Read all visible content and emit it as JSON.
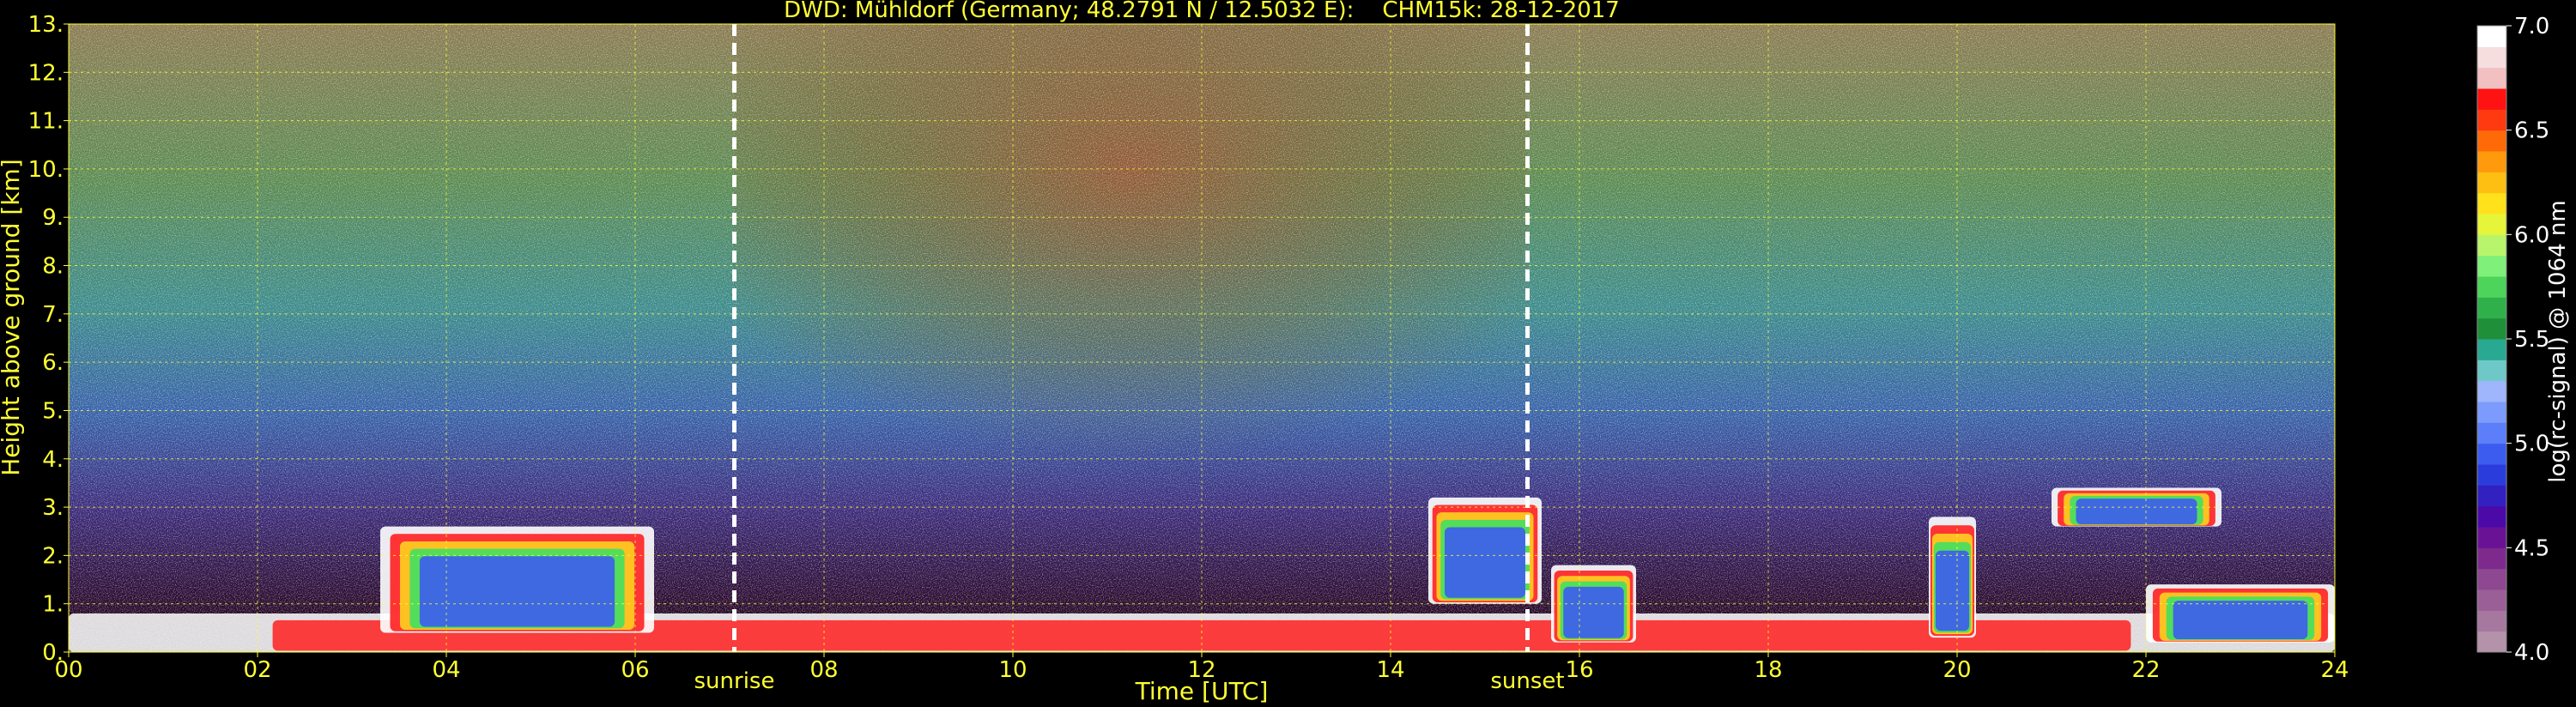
{
  "chart_data": {
    "type": "heatmap",
    "title": "DWD: Mühldorf (Germany; 48.2791 N / 12.5032 E):    CHM15k: 28-12-2017",
    "xlabel": "Time [UTC]",
    "ylabel": "Height above ground [km]",
    "xlim": [
      0,
      24
    ],
    "ylim": [
      0,
      13
    ],
    "x_ticks": [
      "00",
      "02",
      "04",
      "06",
      "08",
      "10",
      "12",
      "14",
      "16",
      "18",
      "20",
      "22",
      "24"
    ],
    "y_ticks": [
      "0.",
      "1.",
      "2.",
      "3.",
      "4.",
      "5.",
      "6.",
      "7.",
      "8.",
      "9.",
      "10.",
      "11.",
      "12.",
      "13."
    ],
    "grid": true,
    "markers": [
      {
        "label": "sunrise",
        "x": 7.05
      },
      {
        "label": "sunset",
        "x": 15.45
      }
    ],
    "colorbar": {
      "label": "log(rc-signal) @ 1064 nm",
      "range": [
        4.0,
        7.0
      ],
      "ticks": [
        "4.0",
        "4.5",
        "5.0",
        "5.5",
        "6.0",
        "6.5",
        "7.0"
      ],
      "colors": [
        "#b493aa",
        "#a6789f",
        "#9b5f98",
        "#8e4791",
        "#7d2a8c",
        "#6a1296",
        "#4b0aa8",
        "#3320c0",
        "#2a3ddc",
        "#3c5cf0",
        "#5c7ef8",
        "#7d9bfc",
        "#9fb6fc",
        "#6fc8c8",
        "#29a892",
        "#1f8f3a",
        "#2fb04a",
        "#4dd45a",
        "#7ff07a",
        "#b8f56a",
        "#e6f53a",
        "#ffe21c",
        "#ffbf12",
        "#ff9a0c",
        "#ff6a08",
        "#ff3a10",
        "#ff1212",
        "#f2c0c0",
        "#f6dede",
        "#ffffff"
      ]
    },
    "features": [
      {
        "name": "boundary layer aerosol",
        "x": [
          0,
          24
        ],
        "height_km": [
          0,
          0.8
        ]
      },
      {
        "name": "cloud layer",
        "x": [
          3.3,
          6.2
        ],
        "height_km": [
          0.4,
          2.6
        ]
      },
      {
        "name": "cloud layer",
        "x": [
          14.4,
          15.6
        ],
        "height_km": [
          1.0,
          3.2
        ]
      },
      {
        "name": "cloud layer",
        "x": [
          15.7,
          16.6
        ],
        "height_km": [
          0.2,
          1.8
        ]
      },
      {
        "name": "cloud layer",
        "x": [
          19.7,
          20.2
        ],
        "height_km": [
          0.3,
          2.8
        ]
      },
      {
        "name": "cloud layer",
        "x": [
          21.0,
          22.8
        ],
        "height_km": [
          2.6,
          3.4
        ]
      },
      {
        "name": "low cloud / fog",
        "x": [
          22.0,
          24
        ],
        "height_km": [
          0.2,
          1.4
        ]
      }
    ]
  }
}
